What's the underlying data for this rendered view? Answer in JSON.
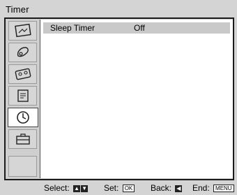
{
  "menu": {
    "title": "Timer",
    "tabs": [
      {
        "icon": "picture-icon"
      },
      {
        "icon": "sound-icon"
      },
      {
        "icon": "tape-icon"
      },
      {
        "icon": "setup-icon"
      },
      {
        "icon": "clock-icon",
        "active": true
      },
      {
        "icon": "briefcase-icon"
      },
      {
        "icon": "blank-icon"
      }
    ],
    "items": [
      {
        "label": "Sleep Timer",
        "value": "Off"
      }
    ]
  },
  "footer": {
    "select": "Select:",
    "set": "Set:",
    "set_key": "OK",
    "back": "Back:",
    "end": "End:",
    "end_key": "MENU"
  }
}
